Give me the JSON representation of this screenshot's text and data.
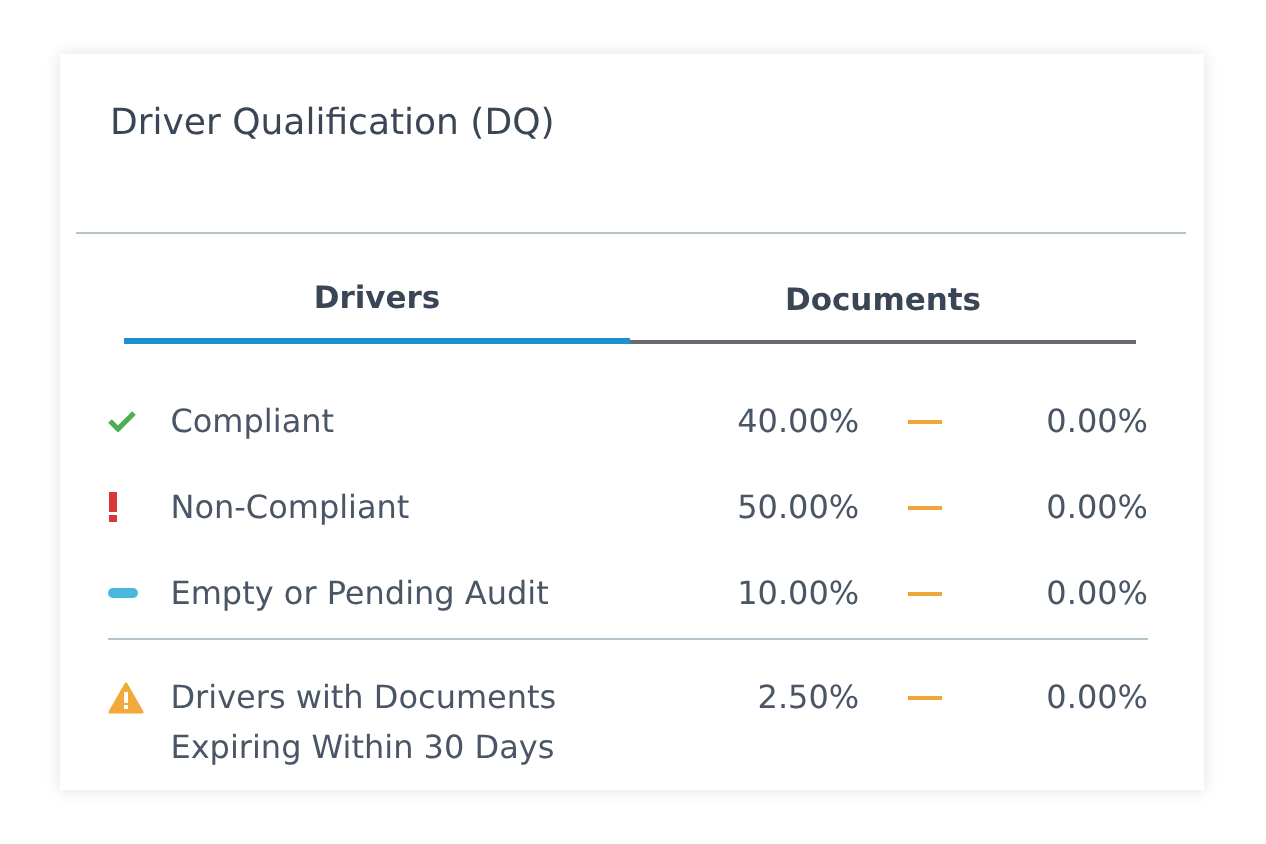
{
  "card": {
    "title": "Driver Qualification (DQ)"
  },
  "tabs": [
    {
      "label": "Drivers",
      "selected": true
    },
    {
      "label": "Documents",
      "selected": false
    }
  ],
  "rows": [
    {
      "kind": "check",
      "label": "Compliant",
      "value": "40.00%",
      "change": "0.00%"
    },
    {
      "kind": "error",
      "label": "Non-Compliant",
      "value": "50.00%",
      "change": "0.00%"
    },
    {
      "kind": "pending",
      "label": "Empty or Pending Audit",
      "value": "10.00%",
      "change": "0.00%"
    }
  ],
  "alerts": [
    {
      "kind": "warning",
      "label": "Drivers with Documents Expiring Within 30 Days",
      "value": "2.50%",
      "change": "0.00%"
    }
  ]
}
